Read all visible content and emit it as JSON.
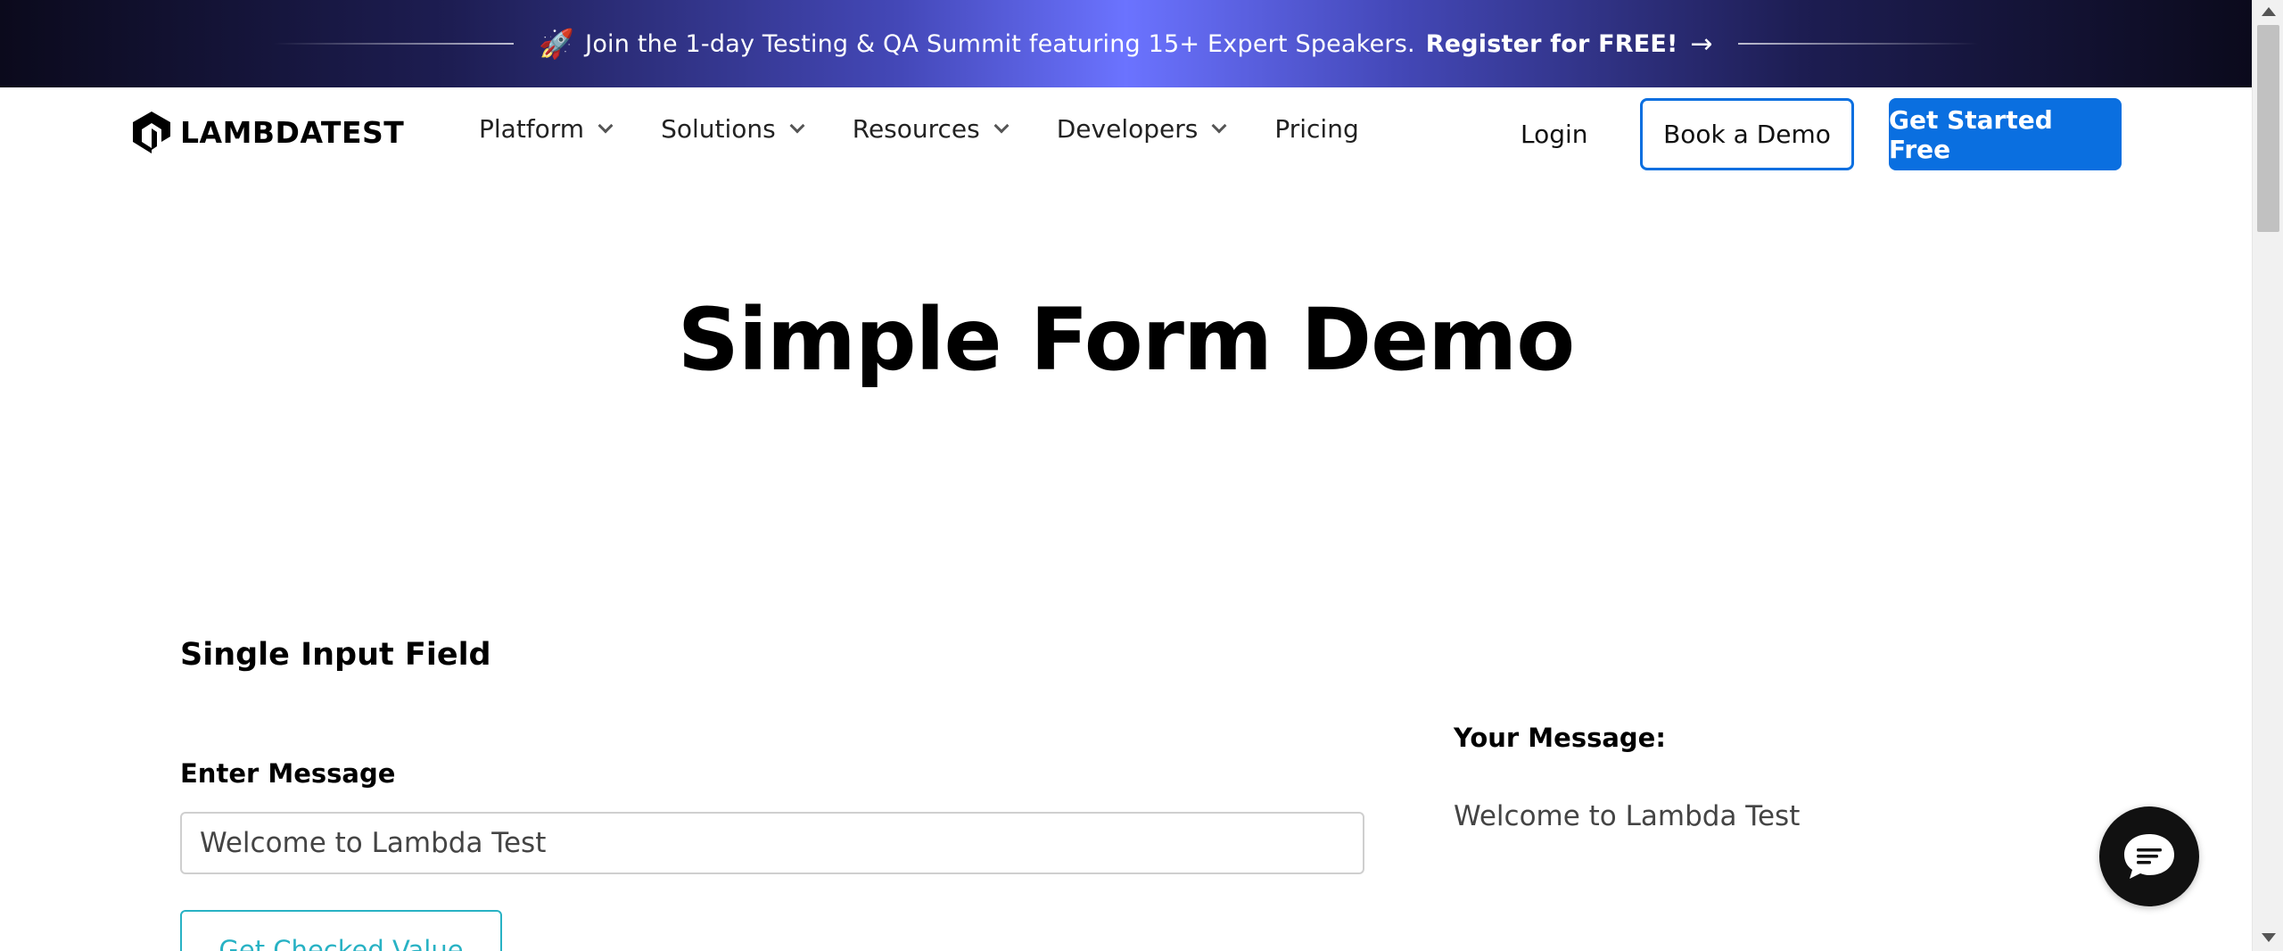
{
  "banner": {
    "icon": "rocket-icon",
    "text": "Join the 1-day Testing & QA Summit featuring 15+ Expert Speakers.",
    "cta": "Register for FREE!",
    "gradient_center": "#6b73ff"
  },
  "header": {
    "logo_text": "LAMBDATEST",
    "nav": [
      {
        "label": "Platform",
        "dropdown": true
      },
      {
        "label": "Solutions",
        "dropdown": true
      },
      {
        "label": "Resources",
        "dropdown": true
      },
      {
        "label": "Developers",
        "dropdown": true
      },
      {
        "label": "Pricing",
        "dropdown": false
      }
    ],
    "login": "Login",
    "book_demo": "Book a Demo",
    "get_started": "Get Started Free",
    "accent": "#0a6fe0"
  },
  "main": {
    "title": "Simple Form Demo",
    "section_title": "Single Input Field",
    "field_label": "Enter Message",
    "input_value": "Welcome to Lambda Test",
    "button_label": "Get Checked Value",
    "button_color": "#28b2c4",
    "your_message_label": "Your Message:",
    "your_message_value": "Welcome to Lambda Test"
  },
  "chat": {
    "icon": "chat-bubble-icon"
  }
}
